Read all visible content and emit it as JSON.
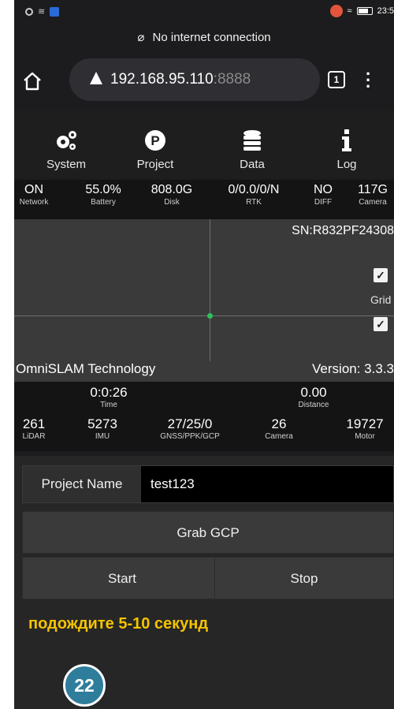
{
  "status_bar": {
    "time": "23:5"
  },
  "network_banner": {
    "text": "No internet connection",
    "icon": "cloud-off-icon"
  },
  "browser": {
    "url_host": "192.168.95.110",
    "url_port": ":8888",
    "tab_count": "1"
  },
  "nav": {
    "items": [
      {
        "label": "System",
        "icon": "gears-icon"
      },
      {
        "label": "Project",
        "icon": "project-p-icon"
      },
      {
        "label": "Data",
        "icon": "database-icon"
      },
      {
        "label": "Log",
        "icon": "info-icon"
      }
    ]
  },
  "stats": [
    {
      "value": "ON",
      "label": "Network"
    },
    {
      "value": "55.0%",
      "label": "Battery"
    },
    {
      "value": "808.0G",
      "label": "Disk"
    },
    {
      "value": "0/0.0/0/N",
      "label": "RTK"
    },
    {
      "value": "NO",
      "label": "DIFF"
    },
    {
      "value": "117G",
      "label": "Camera"
    }
  ],
  "map": {
    "serial": "SN:R832PF24308",
    "grid_label": "Grid",
    "checkbox_1_checked": true,
    "checkbox_2_checked": true
  },
  "company": {
    "name": "OmniSLAM Technology",
    "version": "Version: 3.3.3"
  },
  "time_distance": [
    {
      "value": "0:0:26",
      "label": "Time"
    },
    {
      "value": "0.00",
      "label": "Distance"
    }
  ],
  "counts": [
    {
      "value": "261",
      "label": "LiDAR"
    },
    {
      "value": "5273",
      "label": "IMU"
    },
    {
      "value": "27/25/0",
      "label": "GNSS/PPK/GCP"
    },
    {
      "value": "26",
      "label": "Camera"
    },
    {
      "value": "19727",
      "label": "Motor"
    }
  ],
  "form": {
    "project_name_label": "Project Name",
    "project_name_value": "test123",
    "grab_gcp_label": "Grab GCP",
    "start_label": "Start",
    "stop_label": "Stop"
  },
  "note": "подождите 5-10 секунд",
  "step_badge": "22"
}
